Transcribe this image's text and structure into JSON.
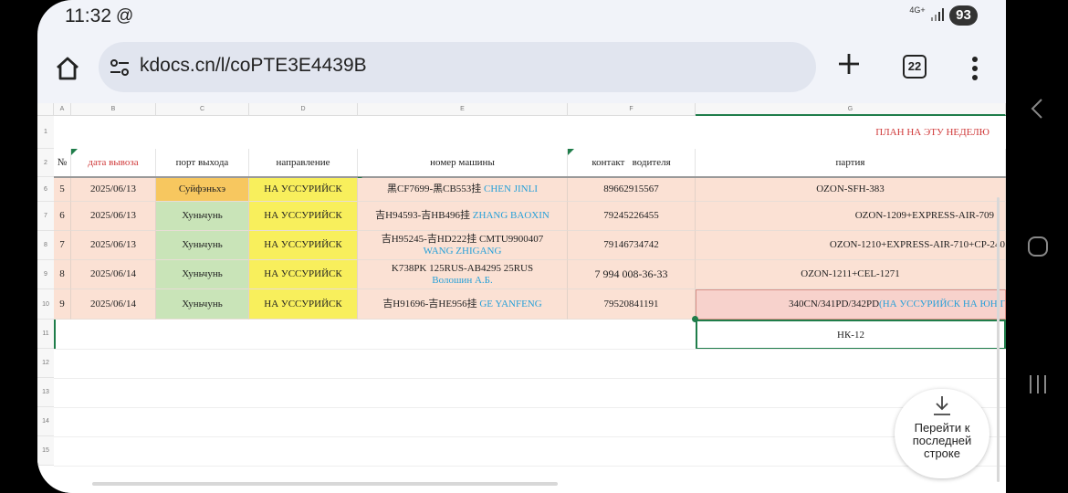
{
  "status": {
    "time": "11:32",
    "at_icon": "@",
    "network": "4G+",
    "battery": "93"
  },
  "browser": {
    "url": "kdocs.cn/l/coPTE3E4439B",
    "tab_count": "22"
  },
  "sheet": {
    "col_letters": [
      "",
      "A",
      "B",
      "C",
      "D",
      "E",
      "F",
      "G"
    ],
    "row_numbers": [
      "1",
      "2",
      "6",
      "7",
      "8",
      "9",
      "10",
      "11",
      "12",
      "13",
      "14",
      "15"
    ],
    "plan_title": "ПЛАН НА ЭТУ НЕДЕЛЮ",
    "headers": {
      "num": "№",
      "date": "дата вывоза",
      "port": "порт выхода",
      "direction": "направление",
      "vehicle": "номер машины",
      "contact": "контакт   водителя",
      "batch": "партия"
    },
    "rows": [
      {
        "num": "5",
        "date": "2025/06/13",
        "port": "Суйфэньхэ",
        "direction": "НА УССУРИЙСК",
        "vehicle": "黑CF7699-黑CB553挂",
        "driver": "CHEN JINLI",
        "contact": "89662915567",
        "batch": "OZON-SFH-383",
        "batch_note": ""
      },
      {
        "num": "6",
        "date": "2025/06/13",
        "port": "Хуньчунь",
        "direction": "НА УССУРИЙСК",
        "vehicle": "吉H94593-吉HB496挂",
        "driver": "ZHANG BAOXIN",
        "contact": "79245226455",
        "batch": "OZON-1209+EXPRESS-AIR-709",
        "batch_note": ""
      },
      {
        "num": "7",
        "date": "2025/06/13",
        "port": "Хуньчунь",
        "direction": "НА УССУРИЙСК",
        "vehicle": "吉H95245-吉HD222挂 CMTU9900407",
        "driver": "WANG ZHIGANG",
        "contact": "79146734742",
        "batch": "OZON-1210+EXPRESS-AIR-710+CP-240",
        "batch_note": ""
      },
      {
        "num": "8",
        "date": "2025/06/14",
        "port": "Хуньчунь",
        "direction": "НА УССУРИЙСК",
        "vehicle": "K738PK 125RUS-AB4295 25RUS",
        "driver": "Волошин А.Б.",
        "contact": "7 994 008-36-33",
        "batch": "OZON-1211+CEL-1271",
        "batch_note": ""
      },
      {
        "num": "9",
        "date": "2025/06/14",
        "port": "Хуньчунь",
        "direction": "НА УССУРИЙСК",
        "vehicle": "吉H91696-吉HE956挂",
        "driver": "GE YANFENG",
        "contact": "79520841191",
        "batch": "340CN/341PD/342PD",
        "batch_note": "(НА УССУРИЙСК НА ЮН Г"
      }
    ],
    "selected_cell": "НК-12"
  },
  "goto_last": {
    "label": "Перейти к\nпоследней\nстроке"
  },
  "colors": {
    "peach": "#fbe1d4",
    "port_green": "#c9e4b8",
    "port_orange": "#f7c75f",
    "direction_yellow": "#f8ef5c",
    "driver_blue": "#27a0d8",
    "title_red": "#d03a3a",
    "selection_green": "#1f7d4a"
  }
}
